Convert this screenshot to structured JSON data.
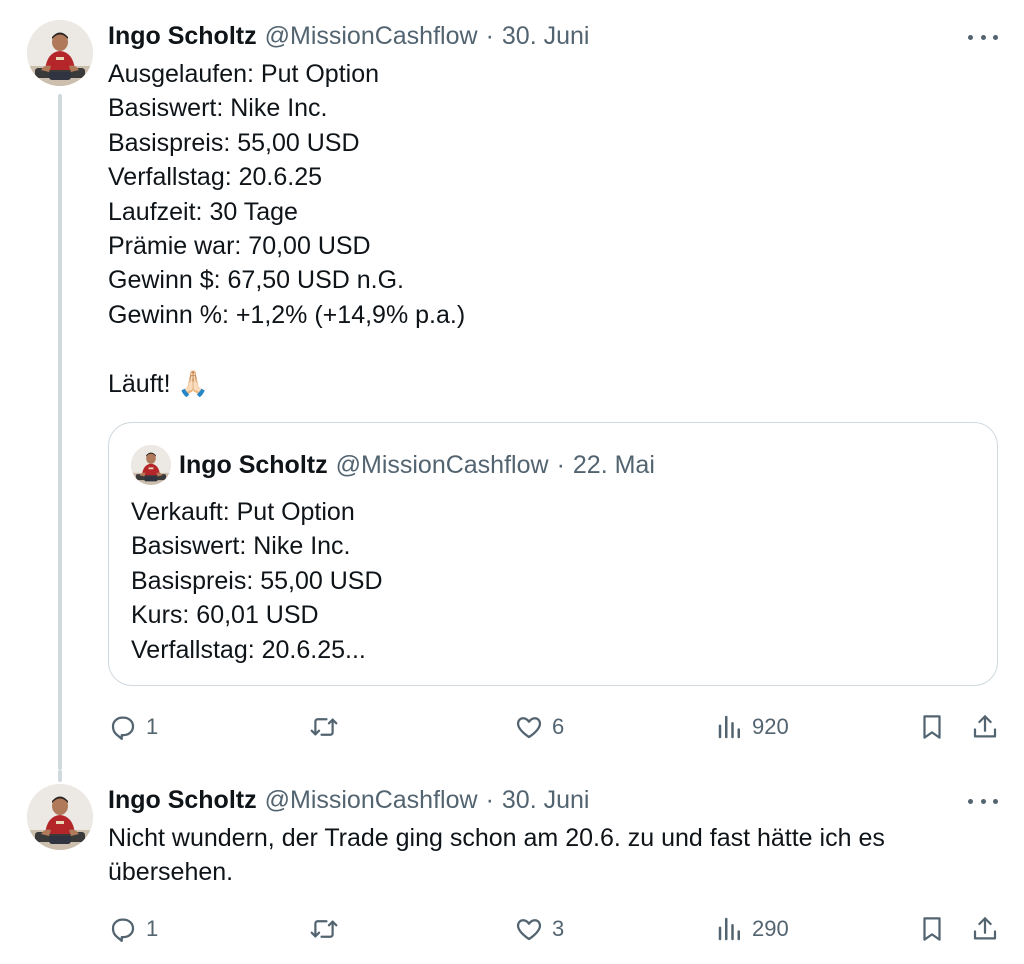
{
  "tweets": [
    {
      "name": "Ingo Scholtz",
      "handle": "@MissionCashflow",
      "separator": "·",
      "date": "30. Juni",
      "text": "Ausgelaufen: Put Option\nBasiswert: Nike Inc.\nBasispreis: 55,00 USD\nVerfallstag: 20.6.25\nLaufzeit: 30 Tage\nPrämie war: 70,00 USD\nGewinn $: 67,50 USD n.G.\nGewinn %: +1,2% (+14,9% p.a.)\n\nLäuft! 🙏🏻",
      "quote": {
        "name": "Ingo Scholtz",
        "handle": "@MissionCashflow",
        "separator": "·",
        "date": "22. Mai",
        "text": "Verkauft: Put Option\nBasiswert: Nike Inc.\nBasispreis: 55,00 USD\nKurs: 60,01 USD\nVerfallstag: 20.6.25..."
      },
      "actions": {
        "replies": "1",
        "reposts": "",
        "likes": "6",
        "views": "920"
      }
    },
    {
      "name": "Ingo Scholtz",
      "handle": "@MissionCashflow",
      "separator": "·",
      "date": "30. Juni",
      "text": "Nicht wundern, der Trade ging schon am 20.6. zu und fast hätte ich es\nübersehen.",
      "actions": {
        "replies": "1",
        "reposts": "",
        "likes": "3",
        "views": "290"
      }
    }
  ],
  "icons": {
    "reply": "reply-icon",
    "repost": "repost-icon",
    "like": "heart-icon",
    "views": "views-icon",
    "bookmark": "bookmark-icon",
    "share": "share-icon",
    "more": "more-icon"
  },
  "colors": {
    "text": "#0f1419",
    "secondary": "#536471",
    "border": "#cfd9de"
  }
}
